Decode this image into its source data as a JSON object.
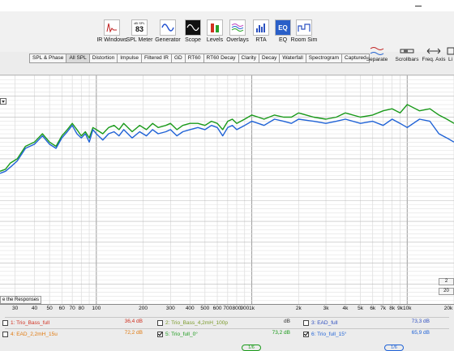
{
  "toolbar": {
    "tools": [
      {
        "label": "IR Windows",
        "icon": "ir-windows-icon"
      },
      {
        "label": "SPL Meter",
        "icon": "spl-meter-icon",
        "badge_top": "dB SPL",
        "badge_value": "83"
      },
      {
        "label": "Generator",
        "icon": "generator-icon"
      },
      {
        "label": "Scope",
        "icon": "scope-icon"
      },
      {
        "label": "Levels",
        "icon": "levels-icon"
      },
      {
        "label": "Overlays",
        "icon": "overlays-icon"
      },
      {
        "label": "RTA",
        "icon": "rta-icon"
      },
      {
        "label": "EQ",
        "icon": "eq-icon"
      },
      {
        "label": "Room Sim",
        "icon": "room-sim-icon"
      }
    ],
    "right_tools": [
      {
        "label": "Separate",
        "icon": "separate-icon"
      },
      {
        "label": "Scrollbars",
        "icon": "scrollbars-icon"
      },
      {
        "label": "Freq. Axis",
        "icon": "freq-axis-icon"
      },
      {
        "label": "Li",
        "icon": "limits-icon"
      }
    ]
  },
  "tabs": [
    "SPL & Phase",
    "All SPL",
    "Distortion",
    "Impulse",
    "Filtered IR",
    "GD",
    "RT60",
    "RT60 Decay",
    "Clarity",
    "Decay",
    "Waterfall",
    "Spectrogram",
    "Captured"
  ],
  "active_tab": "All SPL",
  "plot": {
    "limit_button": "e the Responses",
    "side_buttons": [
      "2",
      "20"
    ]
  },
  "chart_data": {
    "type": "line",
    "xscale": "log",
    "xlim": [
      24,
      20000
    ],
    "x_ticks": [
      "30",
      "40",
      "50",
      "60",
      "70",
      "80",
      "100",
      "200",
      "300",
      "400",
      "500",
      "600",
      "700",
      "800",
      "900",
      "1k",
      "2k",
      "3k",
      "4k",
      "5k",
      "6k",
      "7k",
      "8k",
      "9k",
      "10k",
      "20k"
    ],
    "grid": true,
    "series": [
      {
        "name": "6: Trio_full_15°",
        "color": "#1f62d6",
        "x": [
          24,
          26,
          28,
          31,
          35,
          40,
          45,
          50,
          55,
          60,
          65,
          70,
          75,
          80,
          85,
          90,
          95,
          100,
          110,
          120,
          130,
          140,
          150,
          170,
          190,
          210,
          230,
          250,
          280,
          300,
          330,
          360,
          400,
          450,
          500,
          550,
          600,
          650,
          700,
          750,
          800,
          900,
          1000,
          1100,
          1200,
          1400,
          1600,
          1800,
          2000,
          2500,
          3000,
          3500,
          4000,
          5000,
          6000,
          7000,
          8000,
          9000,
          10000,
          12000,
          14000,
          16000,
          18000,
          20000
        ],
        "y": [
          -27,
          -26,
          -24,
          -21,
          -15,
          -13,
          -9,
          -13,
          -15,
          -10,
          -7,
          -4,
          -8,
          -10,
          -8,
          -12,
          -6,
          -8,
          -11,
          -8,
          -7,
          -9,
          -6,
          -10,
          -7,
          -9,
          -6,
          -8,
          -7,
          -6,
          -9,
          -7,
          -6,
          -5,
          -6,
          -4,
          -5,
          -9,
          -5,
          -4,
          -6,
          -4,
          -2,
          -3,
          -4,
          -1,
          -2,
          -3,
          -1,
          -2,
          -3,
          -2,
          -1,
          -3,
          -2,
          -4,
          -1,
          -3,
          -5,
          -1,
          -2,
          -8,
          -10,
          -12
        ]
      },
      {
        "name": "5: Trio_full_0°",
        "color": "#1a9a1a",
        "x": [
          24,
          26,
          28,
          31,
          35,
          40,
          45,
          50,
          55,
          60,
          65,
          70,
          75,
          80,
          85,
          90,
          95,
          100,
          110,
          120,
          130,
          140,
          150,
          170,
          190,
          210,
          230,
          250,
          280,
          300,
          330,
          360,
          400,
          450,
          500,
          550,
          600,
          650,
          700,
          750,
          800,
          900,
          1000,
          1100,
          1200,
          1400,
          1600,
          1800,
          2000,
          2500,
          3000,
          3500,
          4000,
          5000,
          6000,
          7000,
          8000,
          9000,
          10000,
          12000,
          14000,
          16000,
          18000,
          20000
        ],
        "y": [
          -26,
          -25,
          -22,
          -20,
          -14,
          -12,
          -8,
          -12,
          -14,
          -9,
          -6,
          -3,
          -6,
          -9,
          -7,
          -10,
          -5,
          -6,
          -8,
          -5,
          -4,
          -6,
          -3,
          -7,
          -4,
          -6,
          -3,
          -5,
          -4,
          -3,
          -6,
          -4,
          -3,
          -3,
          -4,
          -2,
          -3,
          -6,
          -2,
          -1,
          -3,
          -1,
          1,
          0,
          -1,
          1,
          0,
          0,
          2,
          0,
          -1,
          0,
          2,
          0,
          1,
          3,
          4,
          2,
          6,
          3,
          4,
          1,
          -1,
          -3
        ]
      }
    ]
  },
  "legend": {
    "rows": [
      [
        {
          "index": "1",
          "name": "1: Trio_Bass_full",
          "value": "36,4 dB",
          "checked": false,
          "color": "#d03020",
          "smoothing": ""
        },
        {
          "index": "2",
          "name": "2: Trio_Bass_4,2mH_100p",
          "value": "dB",
          "checked": false,
          "color": "#7a9a2a",
          "smoothing": ""
        },
        {
          "index": "3",
          "name": "3: EAD_full",
          "value": "73,3 dB",
          "checked": false,
          "color": "#3050c0",
          "smoothing": ""
        }
      ],
      [
        {
          "index": "4",
          "name": "4: EAD_2,2mH_15u",
          "value": "72,2 dB",
          "checked": false,
          "color": "#e07a10",
          "smoothing": ""
        },
        {
          "index": "5",
          "name": "5: Trio_full_0°",
          "value": "73,2 dB",
          "checked": true,
          "color": "#1a9a1a",
          "smoothing": "1/6"
        },
        {
          "index": "6",
          "name": "6: Trio_full_15°",
          "value": "65,9 dB",
          "checked": true,
          "color": "#1f62d6",
          "smoothing": "1/6"
        }
      ]
    ]
  }
}
